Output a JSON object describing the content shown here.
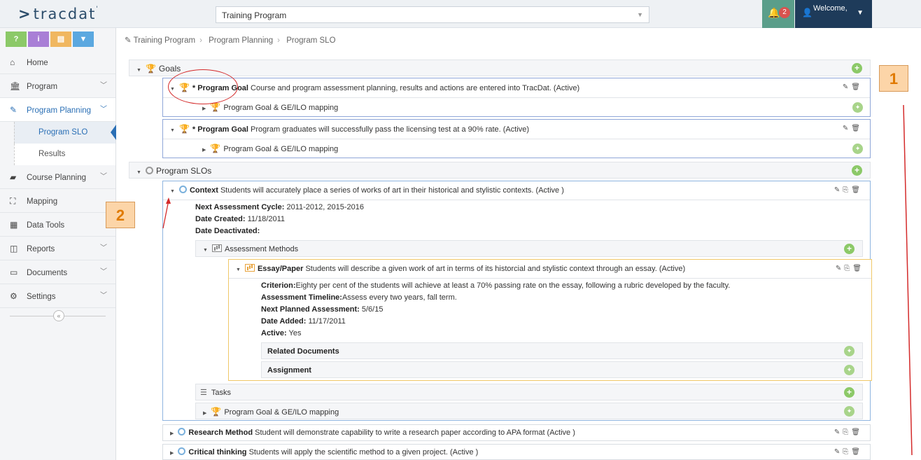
{
  "header": {
    "logo": "tracdat",
    "program_selector": "Training Program",
    "notification_count": "2",
    "welcome": "Welcome,"
  },
  "colors": {
    "quick_green": "#8cc968",
    "quick_purple": "#a97fd6",
    "quick_orange": "#f0b760",
    "quick_blue": "#5ba8e0",
    "accent": "#2a6fb5"
  },
  "quick_actions": [
    {
      "label": "?",
      "icon": "help-icon"
    },
    {
      "label": "i",
      "icon": "info-icon"
    },
    {
      "label": "▤",
      "icon": "notes-icon"
    },
    {
      "label": "▼",
      "icon": "filter-icon"
    }
  ],
  "sidebar": {
    "items": [
      {
        "label": "Home",
        "icon": "home-icon"
      },
      {
        "label": "Program",
        "icon": "building-icon"
      },
      {
        "label": "Program Planning",
        "icon": "pencil-icon"
      },
      {
        "label": "Program SLO"
      },
      {
        "label": "Results"
      },
      {
        "label": "Course Planning",
        "icon": "book-icon"
      },
      {
        "label": "Mapping",
        "icon": "sitemap-icon"
      },
      {
        "label": "Data Tools",
        "icon": "table-icon"
      },
      {
        "label": "Reports",
        "icon": "columns-icon"
      },
      {
        "label": "Documents",
        "icon": "folder-icon"
      },
      {
        "label": "Settings",
        "icon": "gear-icon"
      }
    ]
  },
  "breadcrumb": [
    "Training Program",
    "Program Planning",
    "Program SLO"
  ],
  "goals": {
    "title": "Goals",
    "items": [
      {
        "type": "* Program Goal",
        "text": "Course and program assessment planning, results and actions are entered into TracDat. (Active)",
        "mapping": "Program Goal & GE/ILO mapping"
      },
      {
        "type": "* Program Goal",
        "text": "Program graduates will successfully pass the licensing test at a 90% rate. (Active)",
        "mapping": "Program Goal & GE/ILO mapping"
      }
    ]
  },
  "slos": {
    "title": "Program SLOs",
    "context": {
      "name": "Context",
      "text": "Students will accurately place a series of works of art in their historical and stylistic contexts. (Active )",
      "cycle_label": "Next Assessment Cycle:",
      "cycle_value": "2011-2012, 2015-2016",
      "created_label": "Date Created:",
      "created_value": "11/18/2011",
      "deactivated_label": "Date Deactivated:",
      "methods_title": "Assessment Methods",
      "method": {
        "name": "Essay/Paper",
        "text": "Students will describe a given work of art in terms of its historcial and stylistic context through an essay. (Active)",
        "criterion_label": "Criterion:",
        "criterion_value": "Eighty per cent of the students will achieve at least a 70% passing rate on the essay, following a rubric developed by the faculty.",
        "timeline_label": "Assessment Timeline:",
        "timeline_value": "Assess every two years, fall term.",
        "next_label": "Next Planned Assessment:",
        "next_value": "5/6/15",
        "added_label": "Date Added:",
        "added_value": "11/17/2011",
        "active_label": "Active:",
        "active_value": "Yes",
        "related_docs": "Related Documents",
        "assignment": "Assignment"
      },
      "tasks": "Tasks",
      "mapping": "Program Goal & GE/ILO mapping"
    },
    "research": {
      "name": "Research Method",
      "text": "Student will demonstrate capability to write a research paper according to APA format (Active )"
    },
    "critical": {
      "name": "Critical thinking",
      "text": "Students will apply the scientific method to a given project. (Active )"
    }
  },
  "annotations": [
    "1",
    "2"
  ]
}
